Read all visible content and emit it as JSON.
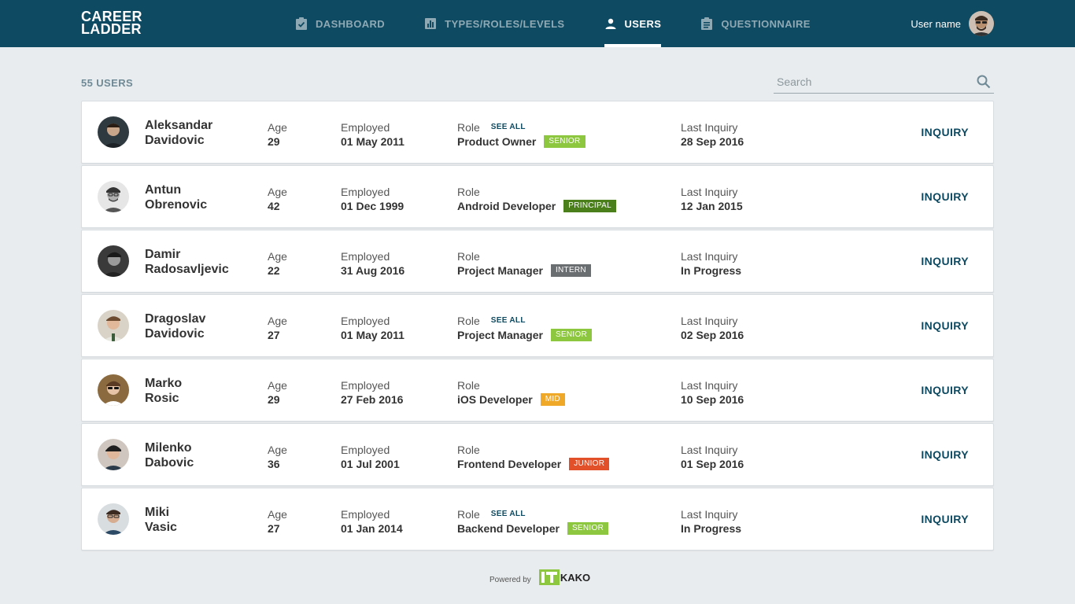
{
  "app": {
    "logo_line1": "CAREER",
    "logo_line2": "LADDER"
  },
  "nav": {
    "items": [
      {
        "label": "DASHBOARD",
        "icon": "clipboard-check-icon"
      },
      {
        "label": "TYPES/ROLES/LEVELS",
        "icon": "bar-chart-icon"
      },
      {
        "label": "USERS",
        "icon": "person-icon",
        "active": true
      },
      {
        "label": "QUESTIONNAIRE",
        "icon": "clipboard-list-icon"
      }
    ]
  },
  "user_menu": {
    "name": "User name"
  },
  "list_header": {
    "count_label": "55 USERS"
  },
  "search": {
    "placeholder": "Search"
  },
  "labels": {
    "age": "Age",
    "employed": "Employed",
    "role": "Role",
    "last_inquiry": "Last Inquiry",
    "see_all": "SEE ALL",
    "inquiry_button": "INQUIRY"
  },
  "users": [
    {
      "first": "Aleksandar",
      "last": "Davidovic",
      "age": "29",
      "employed": "01 May 2011",
      "role": "Product Owner",
      "level": "SENIOR",
      "level_color": "#8dc63f",
      "see_all": true,
      "last_inquiry": "28 Sep 2016"
    },
    {
      "first": "Antun",
      "last": "Obrenovic",
      "age": "42",
      "employed": "01 Dec 1999",
      "role": "Android Developer",
      "level": "PRINCIPAL",
      "level_color": "#4a7f1c",
      "see_all": false,
      "last_inquiry": "12 Jan 2015"
    },
    {
      "first": "Damir",
      "last": "Radosavljevic",
      "age": "22",
      "employed": "31 Aug 2016",
      "role": "Project Manager",
      "level": "INTERN",
      "level_color": "#6b6e70",
      "see_all": false,
      "last_inquiry": "In Progress"
    },
    {
      "first": "Dragoslav",
      "last": "Davidovic",
      "age": "27",
      "employed": "01 May 2011",
      "role": "Project Manager",
      "level": "SENIOR",
      "level_color": "#8dc63f",
      "see_all": true,
      "last_inquiry": "02 Sep 2016"
    },
    {
      "first": "Marko",
      "last": "Rosic",
      "age": "29",
      "employed": "27 Feb 2016",
      "role": "iOS Developer",
      "level": "MID",
      "level_color": "#f0a829",
      "see_all": false,
      "last_inquiry": "10 Sep 2016"
    },
    {
      "first": "Milenko",
      "last": "Dabovic",
      "age": "36",
      "employed": "01 Jul 2001",
      "role": "Frontend Developer",
      "level": "JUNIOR",
      "level_color": "#e2502a",
      "see_all": false,
      "last_inquiry": "01 Sep 2016"
    },
    {
      "first": "Miki",
      "last": "Vasic",
      "age": "27",
      "employed": "01 Jan 2014",
      "role": "Backend Developer",
      "level": "SENIOR",
      "level_color": "#8dc63f",
      "see_all": true,
      "last_inquiry": "In Progress"
    }
  ],
  "footer": {
    "powered_by": "Powered by",
    "brand_mark": "IT",
    "brand_text": "KAKO"
  },
  "colors": {
    "topbar": "#0e4a61",
    "background": "#e9ecee",
    "accent": "#0e4a61"
  }
}
